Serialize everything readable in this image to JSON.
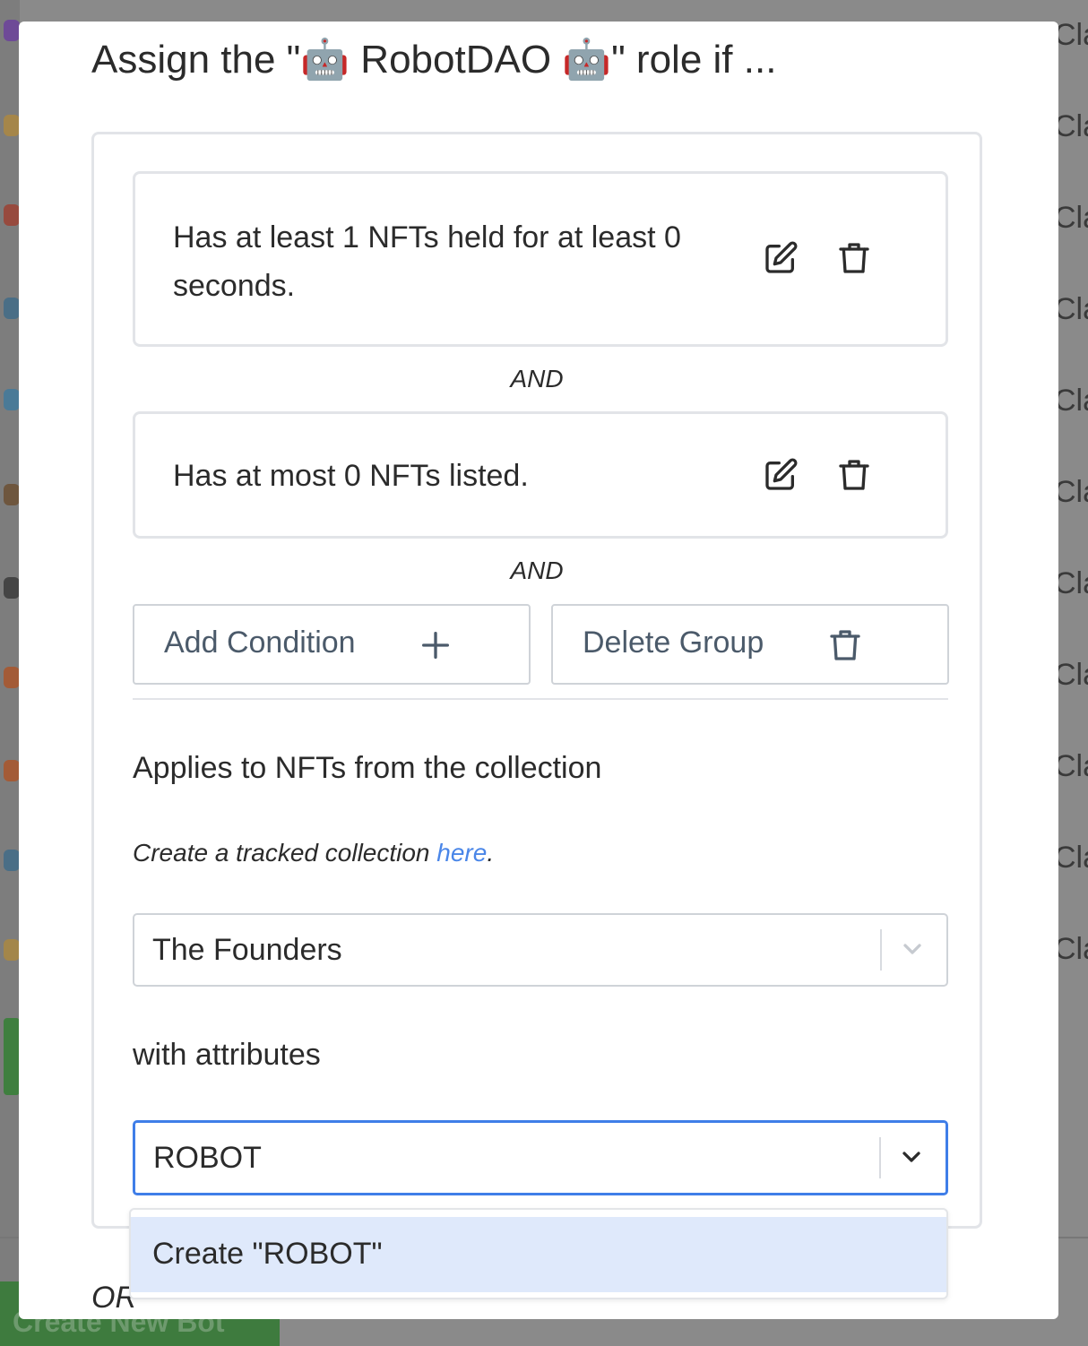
{
  "modal": {
    "title": "Assign the \"🤖 RobotDAO 🤖\" role if ...",
    "conditions": [
      {
        "text": "Has at least 1 NFTs held for at least 0 seconds."
      },
      {
        "text": "Has at most 0 NFTs listed."
      }
    ],
    "and_label": "AND",
    "add_condition_label": "Add Condition",
    "delete_group_label": "Delete Group",
    "collection_label": "Applies to NFTs from the collection",
    "hint_prefix": "Create a tracked collection ",
    "hint_link": "here",
    "hint_suffix": ".",
    "collection_value": "The Founders",
    "attributes_label": "with attributes",
    "attributes_value": "ROBOT",
    "menu_option": "Create \"ROBOT\"",
    "or_label": "OR"
  },
  "background": {
    "right_column_text": "Cla",
    "create_bot_label": "Create New Bot"
  },
  "colors": {
    "link": "#4a86e8",
    "focus_border": "#3f7ee8",
    "menu_highlight": "#dfe9fb",
    "create_bot_bg": "#3e7b3e"
  }
}
